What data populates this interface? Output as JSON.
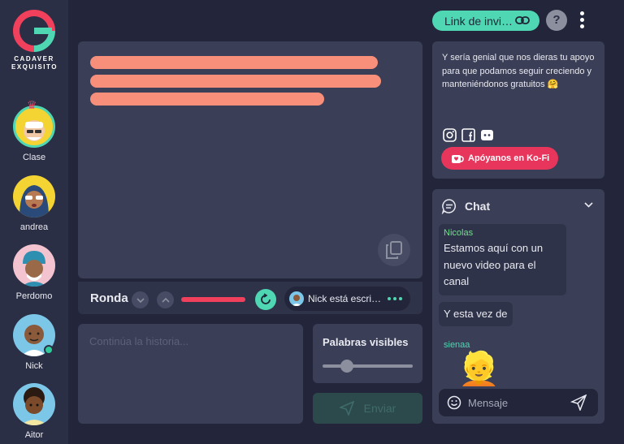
{
  "brand": {
    "line1": "CADAVER",
    "line2": "EXQUISITO"
  },
  "colors": {
    "accent": "#4fd7b3",
    "danger": "#f0405c",
    "redacted": "#f78f7a",
    "kofi": "#e8355b"
  },
  "players": [
    {
      "name": "Clase",
      "host": true,
      "online": false
    },
    {
      "name": "andrea",
      "host": false,
      "online": false
    },
    {
      "name": "Perdomo",
      "host": false,
      "online": false
    },
    {
      "name": "Nick",
      "host": false,
      "online": true
    },
    {
      "name": "Aitor",
      "host": false,
      "online": false
    }
  ],
  "header": {
    "invite_label": "Link de invi…",
    "help_label": "?"
  },
  "round": {
    "label": "Ronda",
    "typing_status": "Nick está escribiendo"
  },
  "story": {
    "input_placeholder": "Continúa la historia..."
  },
  "visible_words": {
    "title": "Palabras visibles",
    "value": 0.2
  },
  "send": {
    "label": "Enviar"
  },
  "kofi": {
    "text": "Y sería genial que nos dieras tu apoyo para que podamos seguir creciendo y manteniéndonos gratuitos 🤗",
    "button_label": "Apóyanos en Ko-Fi"
  },
  "chat": {
    "title": "Chat",
    "messages": [
      {
        "author": "Nicolas",
        "author_color": "#6fe08a",
        "text": "Estamos aquí con un nuevo video para el canal"
      },
      {
        "author": "",
        "text": "Y esta vez de"
      },
      {
        "author": "sienaa",
        "author_color": "#4fd7b3",
        "emoji": "👱"
      }
    ],
    "input_placeholder": "Mensaje"
  }
}
